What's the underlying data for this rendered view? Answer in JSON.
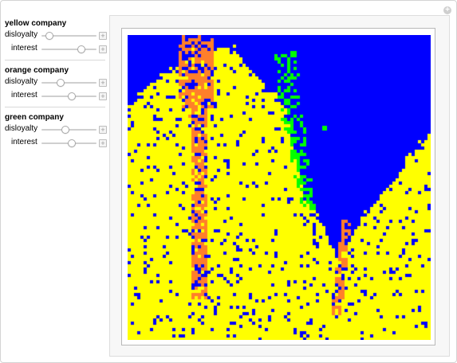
{
  "controls": {
    "groups": [
      {
        "title": "yellow company",
        "sliders": [
          {
            "label": "disloyalty",
            "value": 0.15
          },
          {
            "label": "interest",
            "value": 0.72
          }
        ]
      },
      {
        "title": "orange company",
        "sliders": [
          {
            "label": "disloyalty",
            "value": 0.35
          },
          {
            "label": "interest",
            "value": 0.55
          }
        ]
      },
      {
        "title": "green company",
        "sliders": [
          {
            "label": "disloyalty",
            "value": 0.44
          },
          {
            "label": "interest",
            "value": 0.55
          }
        ]
      }
    ]
  },
  "plot": {
    "colors": {
      "empty": "#0000ff",
      "yellow": "#ffff00",
      "orange": "#ff7f2a",
      "green": "#00ff00"
    }
  }
}
